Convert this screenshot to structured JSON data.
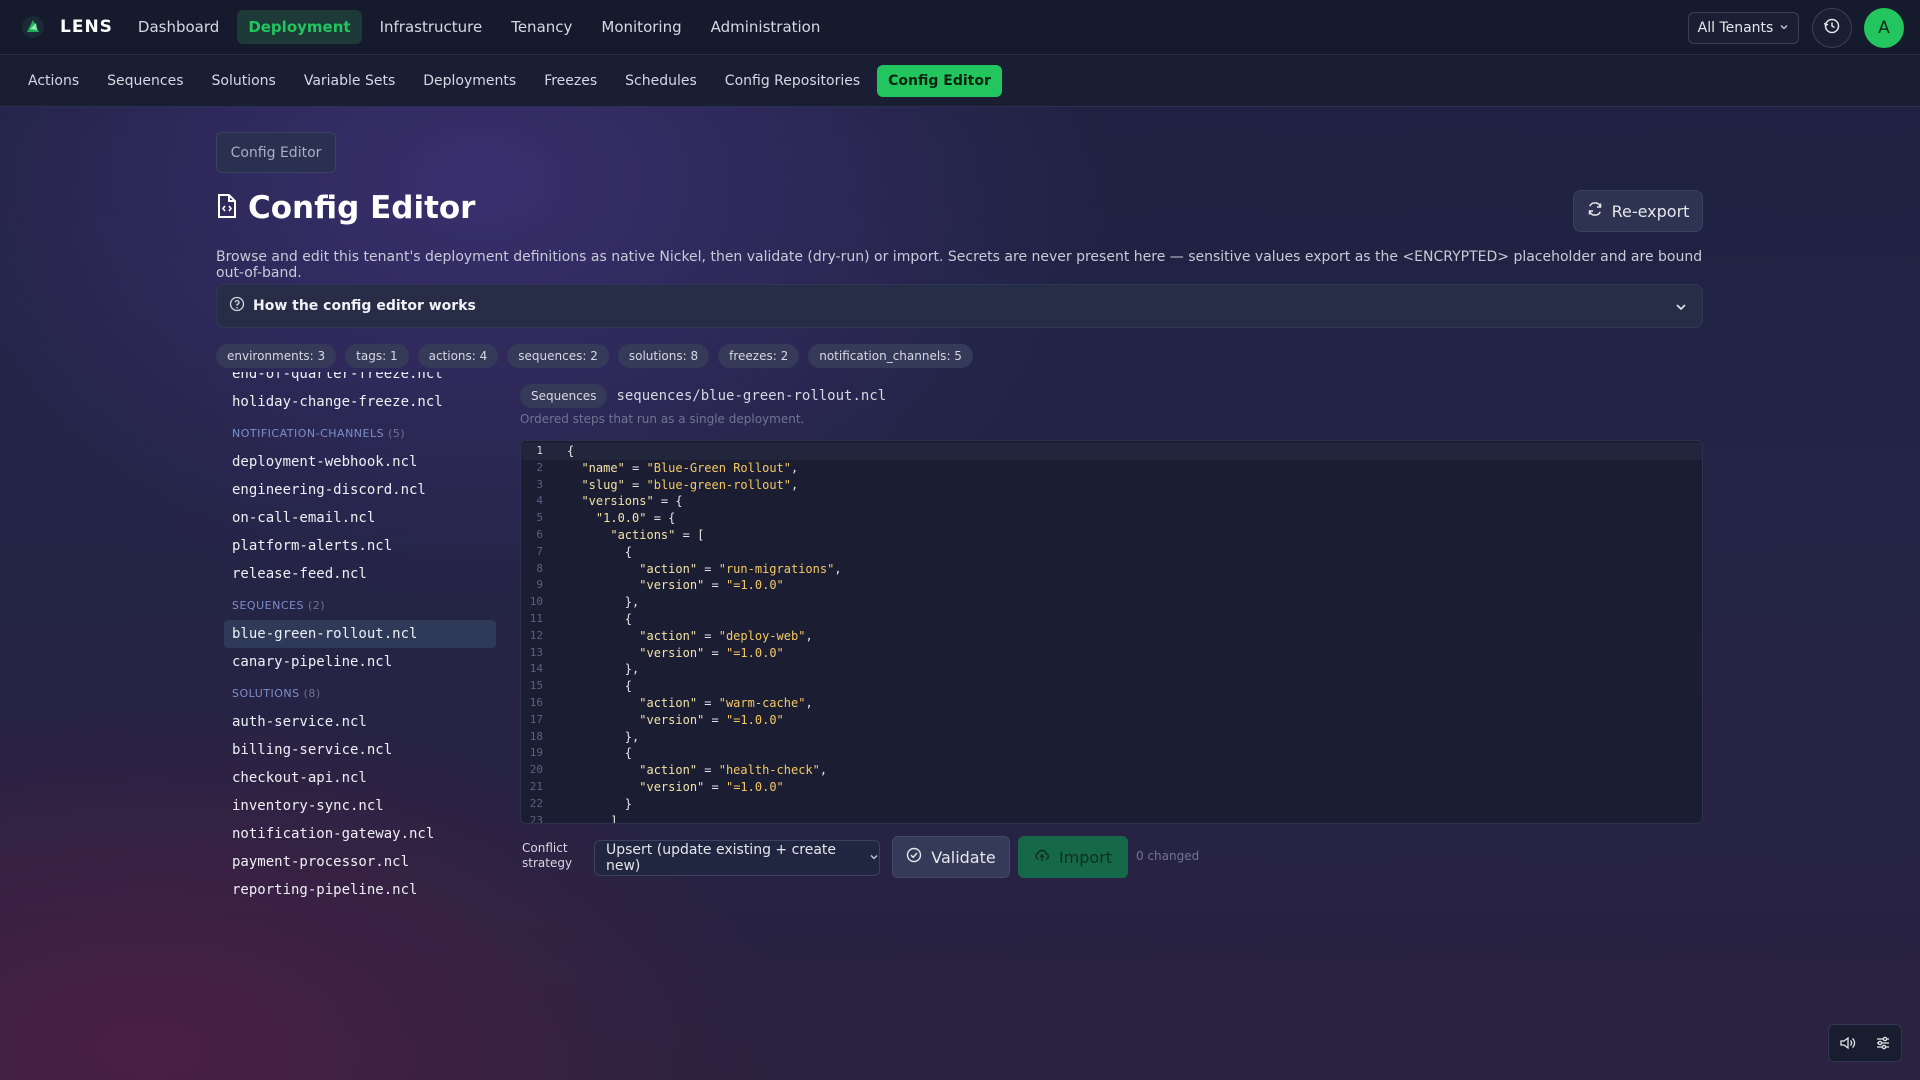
{
  "app": {
    "name": "LENS"
  },
  "topnav": {
    "items": [
      {
        "label": "Dashboard",
        "active": false
      },
      {
        "label": "Deployment",
        "active": true
      },
      {
        "label": "Infrastructure",
        "active": false
      },
      {
        "label": "Tenancy",
        "active": false
      },
      {
        "label": "Monitoring",
        "active": false
      },
      {
        "label": "Administration",
        "active": false
      }
    ],
    "tenant_label": "All Tenants",
    "avatar_initial": "A"
  },
  "subnav": {
    "items": [
      {
        "label": "Actions",
        "active": false
      },
      {
        "label": "Sequences",
        "active": false
      },
      {
        "label": "Solutions",
        "active": false
      },
      {
        "label": "Variable Sets",
        "active": false
      },
      {
        "label": "Deployments",
        "active": false
      },
      {
        "label": "Freezes",
        "active": false
      },
      {
        "label": "Schedules",
        "active": false
      },
      {
        "label": "Config Repositories",
        "active": false
      },
      {
        "label": "Config Editor",
        "active": true
      }
    ]
  },
  "breadcrumb": "Config Editor",
  "page": {
    "title": "Config Editor",
    "reexport_label": "Re-export",
    "description": "Browse and edit this tenant's deployment definitions as native Nickel, then validate (dry-run) or import. Secrets are never present here — sensitive values export as the <ENCRYPTED> placeholder and are bound out-of-band.",
    "howto_label": "How the config editor works"
  },
  "chips": [
    "environments: 3",
    "tags: 1",
    "actions: 4",
    "sequences: 2",
    "solutions: 8",
    "freezes: 2",
    "notification_channels: 5"
  ],
  "tree": {
    "clipped_top": "end-of-quarter-freeze.ncl",
    "pre_files": [
      "holiday-change-freeze.ncl"
    ],
    "groups": [
      {
        "name": "NOTIFICATION-CHANNELS",
        "count": "(5)",
        "files": [
          "deployment-webhook.ncl",
          "engineering-discord.ncl",
          "on-call-email.ncl",
          "platform-alerts.ncl",
          "release-feed.ncl"
        ]
      },
      {
        "name": "SEQUENCES",
        "count": "(2)",
        "files": [
          "blue-green-rollout.ncl",
          "canary-pipeline.ncl"
        ]
      },
      {
        "name": "SOLUTIONS",
        "count": "(8)",
        "files": [
          "auth-service.ncl",
          "billing-service.ncl",
          "checkout-api.ncl",
          "inventory-sync.ncl",
          "notification-gateway.ncl",
          "payment-processor.ncl",
          "reporting-pipeline.ncl"
        ]
      }
    ],
    "selected": "blue-green-rollout.ncl"
  },
  "editor": {
    "category": "Sequences",
    "path": "sequences/blue-green-rollout.ncl",
    "description": "Ordered steps that run as a single deployment.",
    "lines": [
      "{",
      "  \"name\" = \"Blue-Green Rollout\",",
      "  \"slug\" = \"blue-green-rollout\",",
      "  \"versions\" = {",
      "    \"1.0.0\" = {",
      "      \"actions\" = [",
      "        {",
      "          \"action\" = \"run-migrations\",",
      "          \"version\" = \"=1.0.0\"",
      "        },",
      "        {",
      "          \"action\" = \"deploy-web\",",
      "          \"version\" = \"=1.0.0\"",
      "        },",
      "        {",
      "          \"action\" = \"warm-cache\",",
      "          \"version\" = \"=1.0.0\"",
      "        },",
      "        {",
      "          \"action\" = \"health-check\",",
      "          \"version\" = \"=1.0.0\"",
      "        }",
      "      ]"
    ]
  },
  "actions": {
    "conflict_label": "Conflict strategy",
    "strategy_value": "Upsert (update existing + create new)",
    "validate_label": "Validate",
    "import_label": "Import",
    "changed_text": "0 changed"
  },
  "colors": {
    "accent": "#22c55e",
    "accent_bg": "#1d3a38",
    "import_bg": "#16684a",
    "string": "#f5c862"
  },
  "icons": [
    "lens-logo-icon",
    "chevron-down-icon",
    "history-icon",
    "file-code-icon",
    "refresh-icon",
    "help-circle-icon",
    "check-circle-icon",
    "cloud-upload-icon",
    "volume-icon",
    "sliders-icon"
  ]
}
